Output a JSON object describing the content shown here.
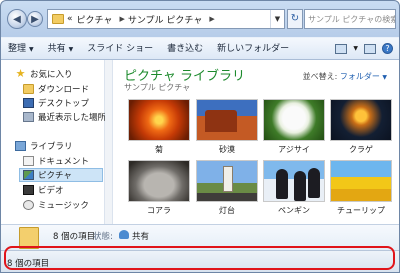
{
  "address": {
    "crumbs": [
      "ピクチャ",
      "サンプル ピクチャ"
    ],
    "prefix": "«",
    "search_placeholder": "サンプル ピクチャの検索"
  },
  "toolbar": {
    "organize": "整理",
    "share": "共有",
    "slideshow": "スライド ショー",
    "burn": "書き込む",
    "new_folder": "新しいフォルダー"
  },
  "navigation": {
    "favorites": "お気に入り",
    "downloads": "ダウンロード",
    "desktop": "デスクトップ",
    "recent": "最近表示した場所",
    "libraries": "ライブラリ",
    "documents": "ドキュメント",
    "pictures": "ピクチャ",
    "videos": "ビデオ",
    "music": "ミュージック"
  },
  "library": {
    "title": "ピクチャ ライブラリ",
    "subtitle": "サンプル ピクチャ",
    "arrange_label": "並べ替え:",
    "arrange_value": "フォルダー"
  },
  "thumbnails": [
    "菊",
    "砂漠",
    "アジサイ",
    "クラゲ",
    "コアラ",
    "灯台",
    "ペンギン",
    "チューリップ"
  ],
  "details": {
    "count": "8 個の項目",
    "state_label": "状態:",
    "state_value": "共有"
  },
  "status": {
    "text": "8 個の項目"
  }
}
